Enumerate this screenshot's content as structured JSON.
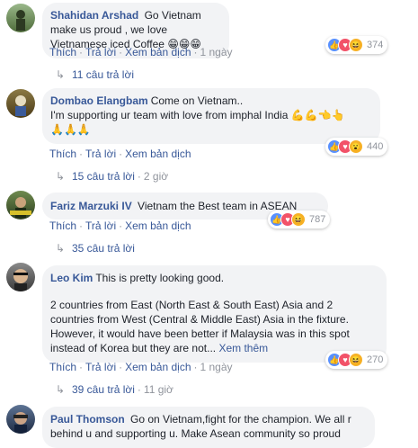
{
  "comments": [
    {
      "name": "Shahidan Arshad",
      "text": "Go Vietnam make us proud , we love Vietnamese iced Coffee",
      "emoji": "😁😁😁",
      "reaction_count": "374",
      "time": "1 ngày",
      "replies": "11 câu trả lời",
      "avatar_color": "#6a8b58"
    },
    {
      "name": "Dombao Elangbam",
      "text_line1": "Come on Vietnam..",
      "text_line2": "I'm supporting ur team with love from imphal India",
      "emoji1": "💪💪👈👆",
      "emoji2": "🙏🙏🙏",
      "reaction_count": "440",
      "replies": "15 câu trả lời",
      "replies_time": "2 giờ",
      "avatar_color": "#6b5b2c"
    },
    {
      "name": "Fariz Marzuki IV",
      "text": "Vietnam the Best team in ASEAN",
      "reaction_count": "787",
      "replies": "35 câu trả lời",
      "avatar_color": "#3d5a2a"
    },
    {
      "name": "Leo Kim",
      "text_line1": "This is pretty looking good.",
      "text_para2": "2 countries from East (North East & South East) Asia and 2 countries from West (Central & Middle East) Asia in the fixture. However, it would have been better if Malaysia was in this spot instead of Korea but they are not...",
      "see_more": "Xem thêm",
      "reaction_count": "270",
      "time": "1 ngày",
      "replies": "39 câu trả lời",
      "replies_time": "11 giờ",
      "avatar_color": "#505050"
    },
    {
      "name": "Paul Thomson",
      "text": "Go on Vietnam,fight for the champion. We all r behind u and supporting u. Make Asean community so proud",
      "avatar_color": "#2b3d57"
    }
  ],
  "actions": {
    "like": "Thích",
    "reply": "Trả lời",
    "translate": "Xem bản dịch",
    "dot": "·"
  },
  "colors": {
    "link": "#385898",
    "bubble": "#f2f3f5",
    "like_icon": "#5890ff",
    "love_icon": "#f25268"
  }
}
